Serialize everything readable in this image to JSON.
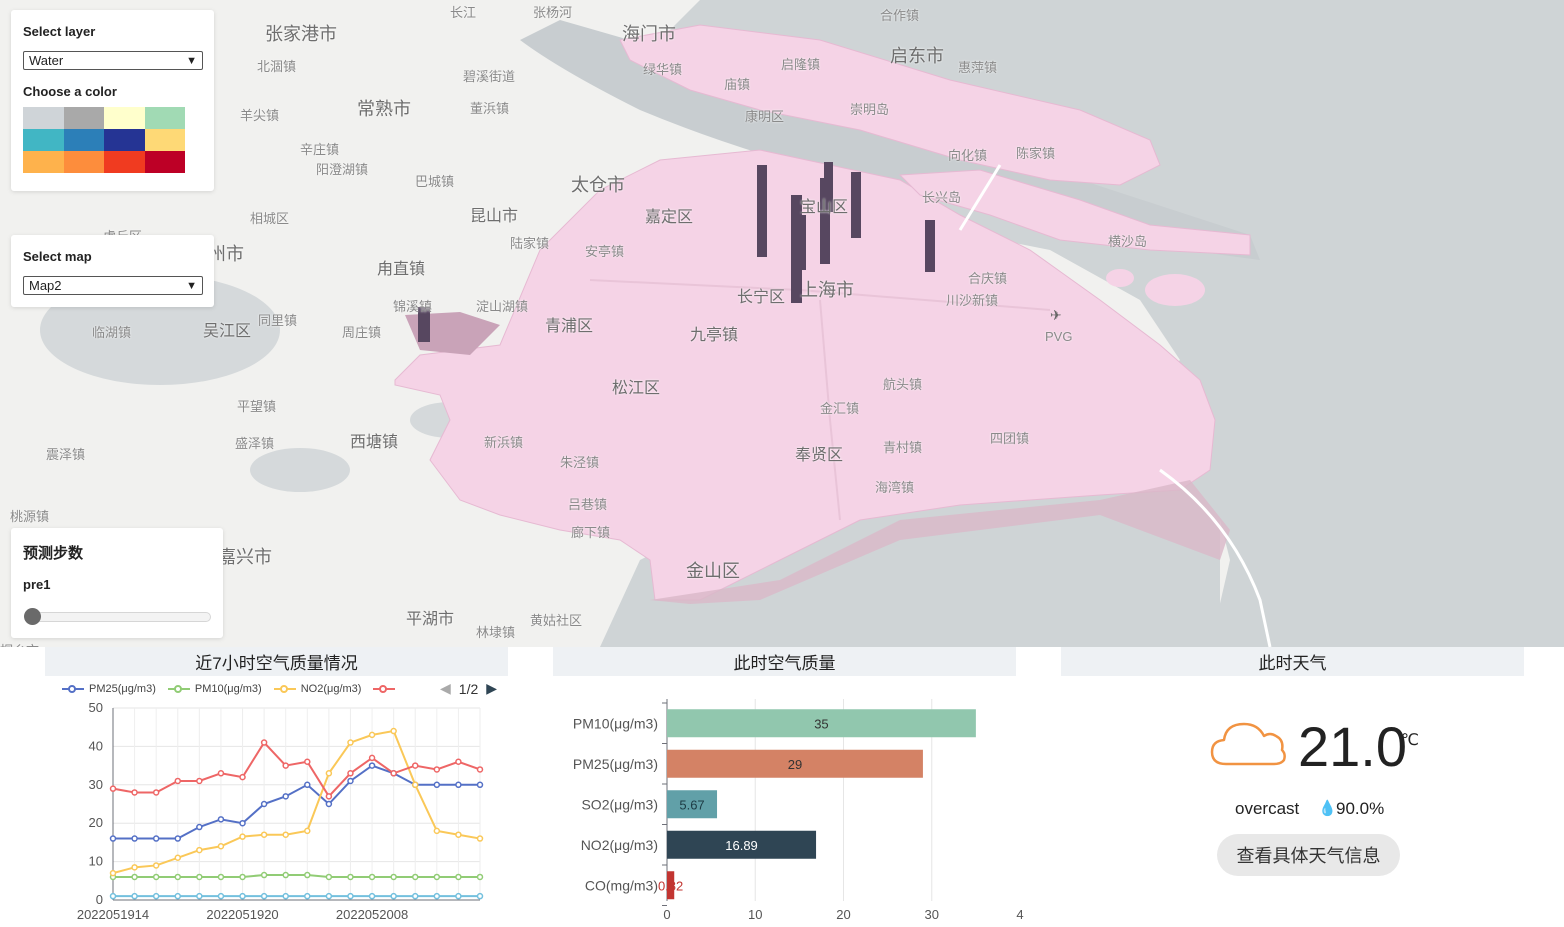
{
  "map": {
    "place_labels": [
      {
        "text": "张家港市",
        "cls": "big"
      },
      {
        "text": "海门市",
        "cls": "big"
      },
      {
        "text": "启东市",
        "cls": "big"
      },
      {
        "text": "常熟市",
        "cls": "big"
      },
      {
        "text": "太仓市",
        "cls": "big"
      },
      {
        "text": "苏州市",
        "cls": "big"
      },
      {
        "text": "上海市",
        "cls": "big"
      },
      {
        "text": "嘉定区",
        "cls": "mid"
      },
      {
        "text": "青浦区",
        "cls": "mid"
      },
      {
        "text": "松江区",
        "cls": "mid"
      },
      {
        "text": "长宁区",
        "cls": "mid"
      },
      {
        "text": "宝山区",
        "cls": "mid"
      },
      {
        "text": "奉贤区",
        "cls": "mid"
      },
      {
        "text": "金山区",
        "cls": "big"
      },
      {
        "text": "吴江区",
        "cls": "mid"
      },
      {
        "text": "虎丘区",
        "cls": "sm"
      },
      {
        "text": "北涸镇",
        "cls": "sm"
      },
      {
        "text": "碧溪街道",
        "cls": "sm"
      },
      {
        "text": "董浜镇",
        "cls": "sm"
      },
      {
        "text": "羊尖镇",
        "cls": "sm"
      },
      {
        "text": "辛庄镇",
        "cls": "sm"
      },
      {
        "text": "阳澄湖镇",
        "cls": "sm"
      },
      {
        "text": "巴城镇",
        "cls": "sm"
      },
      {
        "text": "相城区",
        "cls": "sm"
      },
      {
        "text": "昆山市",
        "cls": "mid"
      },
      {
        "text": "陆家镇",
        "cls": "sm"
      },
      {
        "text": "安亭镇",
        "cls": "sm"
      },
      {
        "text": "甪直镇",
        "cls": "mid"
      },
      {
        "text": "锦溪镇",
        "cls": "sm"
      },
      {
        "text": "淀山湖镇",
        "cls": "sm"
      },
      {
        "text": "同里镇",
        "cls": "sm"
      },
      {
        "text": "周庄镇",
        "cls": "sm"
      },
      {
        "text": "临湖镇",
        "cls": "sm"
      },
      {
        "text": "九亭镇",
        "cls": "mid"
      },
      {
        "text": "平望镇",
        "cls": "sm"
      },
      {
        "text": "盛泽镇",
        "cls": "sm"
      },
      {
        "text": "西塘镇",
        "cls": "mid"
      },
      {
        "text": "震泽镇",
        "cls": "sm"
      },
      {
        "text": "新浜镇",
        "cls": "sm"
      },
      {
        "text": "朱泾镇",
        "cls": "sm"
      },
      {
        "text": "吕巷镇",
        "cls": "sm"
      },
      {
        "text": "廊下镇",
        "cls": "sm"
      },
      {
        "text": "金汇镇",
        "cls": "sm"
      },
      {
        "text": "航头镇",
        "cls": "sm"
      },
      {
        "text": "青村镇",
        "cls": "sm"
      },
      {
        "text": "海湾镇",
        "cls": "sm"
      },
      {
        "text": "四团镇",
        "cls": "sm"
      },
      {
        "text": "川沙新镇",
        "cls": "sm"
      },
      {
        "text": "合庆镇",
        "cls": "sm"
      },
      {
        "text": "长兴岛",
        "cls": "sm"
      },
      {
        "text": "横沙岛",
        "cls": "sm"
      },
      {
        "text": "向化镇",
        "cls": "sm"
      },
      {
        "text": "陈家镇",
        "cls": "sm"
      },
      {
        "text": "崇明岛",
        "cls": "sm"
      },
      {
        "text": "庙镇",
        "cls": "sm"
      },
      {
        "text": "绿华镇",
        "cls": "sm"
      },
      {
        "text": "启隆镇",
        "cls": "sm"
      },
      {
        "text": "康明区",
        "cls": "sm"
      },
      {
        "text": "惠萍镇",
        "cls": "sm"
      },
      {
        "text": "桃源镇",
        "cls": "sm"
      },
      {
        "text": "平湖市",
        "cls": "mid"
      },
      {
        "text": "林埭镇",
        "cls": "sm"
      },
      {
        "text": "黄姑社区",
        "cls": "sm"
      },
      {
        "text": "桐乡市",
        "cls": "sm"
      },
      {
        "text": "长江",
        "cls": "sm"
      },
      {
        "text": "张杨河",
        "cls": "sm"
      },
      {
        "text": "合作镇",
        "cls": "sm"
      },
      {
        "text": "嘉兴市",
        "cls": "big"
      },
      {
        "text": "PVG",
        "cls": "sm"
      }
    ]
  },
  "layer_panel": {
    "select_layer_label": "Select layer",
    "layer_value": "Water",
    "choose_color_label": "Choose a color",
    "swatches": [
      "#cfd4d8",
      "#a9a9a9",
      "#ffffcc",
      "#a1dab4",
      "#41b6c4",
      "#2c7fb8",
      "#253494",
      "#fed976",
      "#feb24c",
      "#fd8d3c",
      "#f03b20",
      "#bd0026"
    ]
  },
  "map_panel": {
    "select_map_label": "Select map",
    "map_value": "Map2"
  },
  "prediction_panel": {
    "title": "预测步数",
    "step_label": "pre1",
    "slider_position": 0
  },
  "charts": {
    "left_title": "近7小时空气质量情况",
    "mid_title": "此时空气质量",
    "right_title": "此时天气",
    "legend_page": "1/2"
  },
  "weather": {
    "temperature": "21.0",
    "unit": "℃",
    "condition": "overcast",
    "humidity": "90.0%",
    "button_label": "查看具体天气信息",
    "icon": "cloud-icon"
  },
  "chart_data": [
    {
      "type": "line",
      "title": "近7小时空气质量情况",
      "x": [
        1,
        2,
        3,
        4,
        5,
        6,
        7,
        8,
        9,
        10,
        11,
        12,
        13,
        14,
        15,
        16,
        17,
        18
      ],
      "xtick_labels": [
        "2022051914",
        "2022051920",
        "2022052008"
      ],
      "xtick_positions": [
        1,
        7,
        13
      ],
      "ylim": [
        0,
        50
      ],
      "yticks": [
        0,
        10,
        20,
        30,
        40,
        50
      ],
      "grid": true,
      "legend_position": "top",
      "series": [
        {
          "name": "PM25(μg/m3)",
          "color": "#5470c6",
          "values": [
            16,
            16,
            16,
            16,
            19,
            21,
            20,
            25,
            27,
            30,
            25,
            31,
            35,
            33,
            30,
            30,
            30,
            30
          ]
        },
        {
          "name": "PM10(μg/m3)",
          "color": "#91cc75",
          "values": [
            6,
            6,
            6,
            6,
            6,
            6,
            6,
            6.5,
            6.5,
            6.5,
            6,
            6,
            6,
            6,
            6,
            6,
            6,
            6
          ]
        },
        {
          "name": "NO2(μg/m3)",
          "color": "#fac858",
          "values": [
            7,
            8.5,
            9,
            11,
            13,
            14,
            16.5,
            17,
            17,
            18,
            33,
            41,
            43,
            44,
            30,
            18,
            17,
            16
          ]
        },
        {
          "name": "",
          "color": "#ee6666",
          "values": [
            29,
            28,
            28,
            31,
            31,
            33,
            32,
            41,
            35,
            36,
            27,
            33,
            37,
            33,
            35,
            34,
            36,
            34
          ]
        },
        {
          "name": "",
          "color": "#73c0de",
          "values": [
            1,
            1,
            1,
            1,
            1,
            1,
            1,
            1,
            1,
            1,
            1,
            1,
            1,
            1,
            1,
            1,
            1,
            1
          ]
        }
      ]
    },
    {
      "type": "bar",
      "title": "此时空气质量",
      "orientation": "horizontal",
      "categories": [
        "PM10(μg/m3)",
        "PM25(μg/m3)",
        "SO2(μg/m3)",
        "NO2(μg/m3)",
        "CO(mg/m3)"
      ],
      "values": [
        35,
        29,
        5.67,
        16.89,
        0.82
      ],
      "labels": [
        "35",
        "29",
        "5.67",
        "16.89",
        "0.82"
      ],
      "colors": [
        "#91c7ae",
        "#d48265",
        "#61a0a8",
        "#2f4554",
        "#c23531"
      ],
      "xlim": [
        0,
        40
      ],
      "xticks": [
        0,
        10,
        20,
        30,
        4
      ],
      "grid": true
    }
  ]
}
